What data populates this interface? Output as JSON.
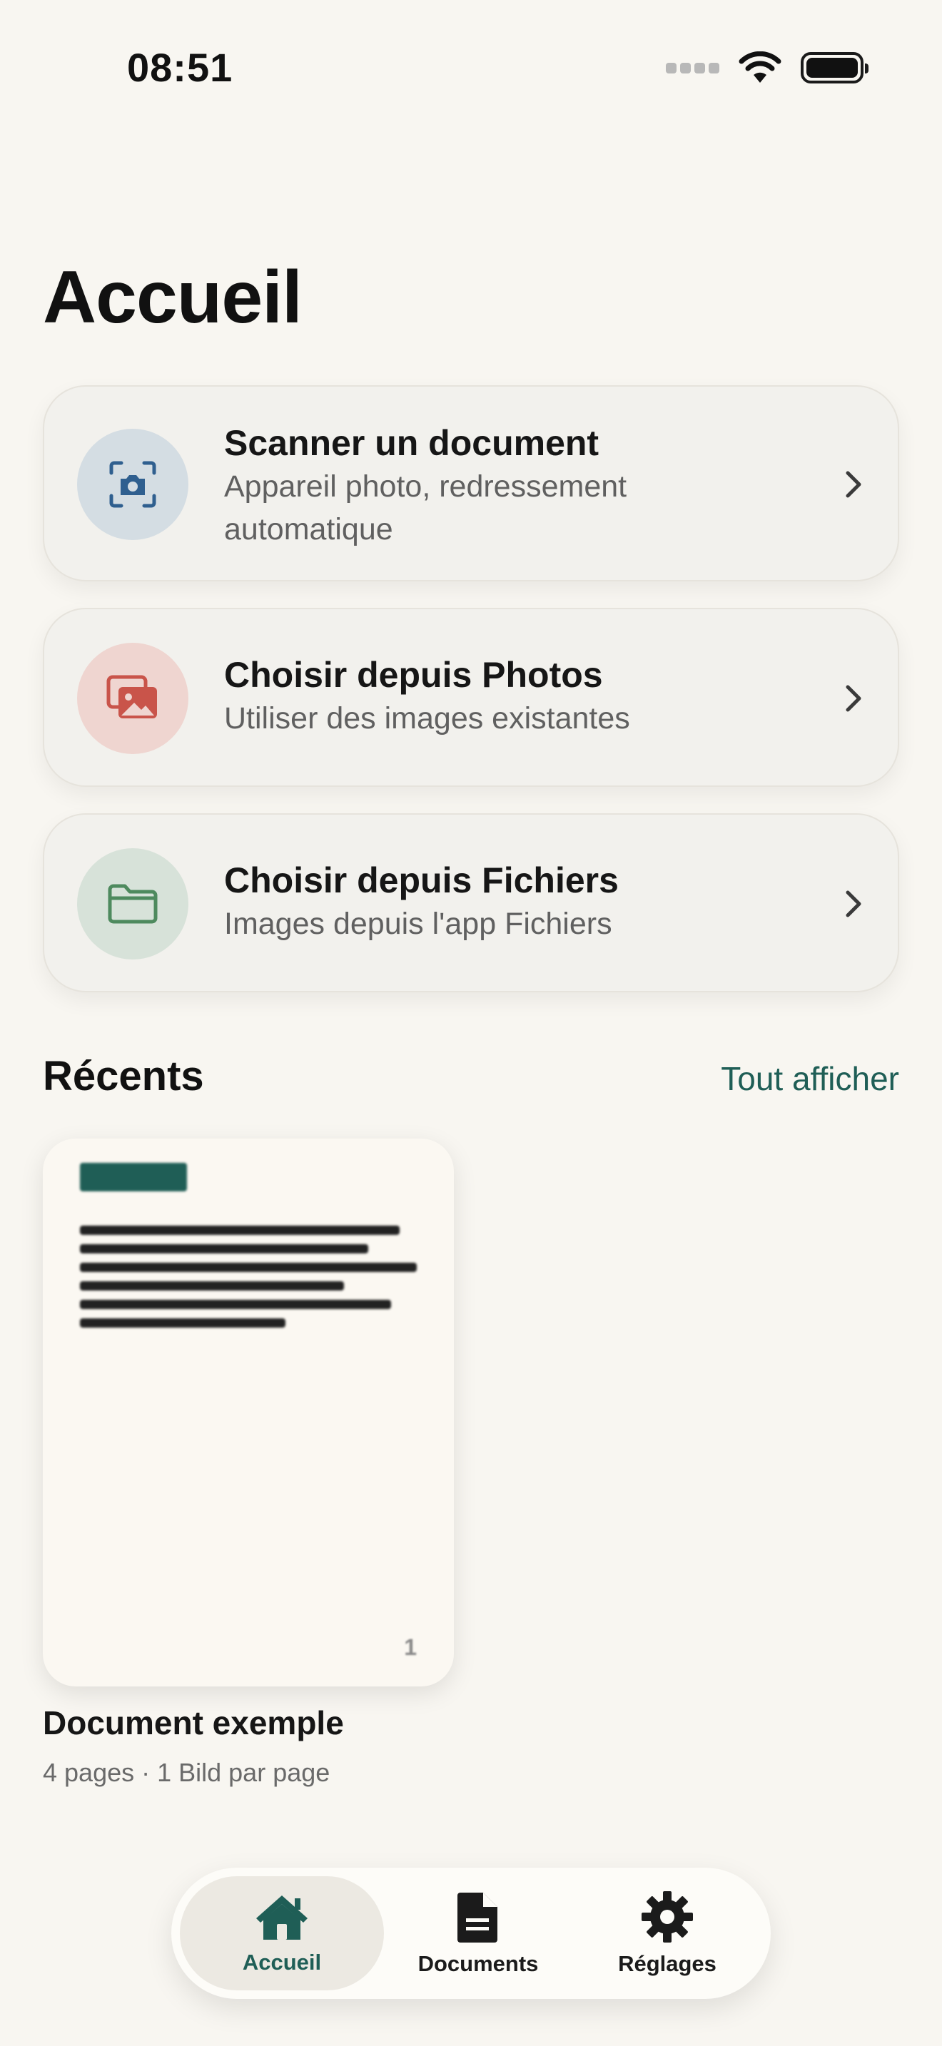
{
  "status_bar": {
    "time": "08:51",
    "icons": [
      "cellular-signal-icon",
      "wifi-icon",
      "battery-icon"
    ]
  },
  "header": {
    "title": "Accueil"
  },
  "actions": [
    {
      "title": "Scanner un document",
      "subtitle": "Appareil photo, redressement automatique",
      "icon": "camera-scan-icon",
      "accent": "#2f5f8f"
    },
    {
      "title": "Choisir depuis Photos",
      "subtitle": "Utiliser des images existantes",
      "icon": "photos-icon",
      "accent": "#c9544a"
    },
    {
      "title": "Choisir depuis Fichiers",
      "subtitle": "Images depuis l'app Fichiers",
      "icon": "folder-icon",
      "accent": "#4e8a5e"
    }
  ],
  "recents": {
    "title": "Récents",
    "see_all_label": "Tout afficher",
    "items": [
      {
        "name": "Document exemple",
        "meta": "4 pages · 1 Bild par page",
        "page_badge": "1"
      }
    ]
  },
  "tab_bar": {
    "selected": "Accueil",
    "tabs": [
      {
        "label": "Accueil",
        "icon": "house-icon"
      },
      {
        "label": "Documents",
        "icon": "document-icon"
      },
      {
        "label": "Réglages",
        "icon": "gear-icon"
      }
    ]
  },
  "colors": {
    "background": "#f8f6f1",
    "accent": "#1f5e56"
  }
}
